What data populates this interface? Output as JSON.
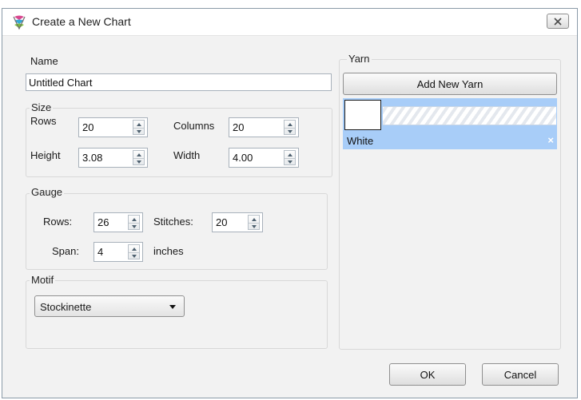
{
  "window": {
    "title": "Create a New Chart"
  },
  "name_field": {
    "label": "Name",
    "value": "Untitled Chart"
  },
  "size": {
    "title": "Size",
    "rows_label": "Rows",
    "rows_value": "20",
    "columns_label": "Columns",
    "columns_value": "20",
    "height_label": "Height",
    "height_value": "3.08",
    "width_label": "Width",
    "width_value": "4.00"
  },
  "gauge": {
    "title": "Gauge",
    "rows_label": "Rows:",
    "rows_value": "26",
    "stitches_label": "Stitches:",
    "stitches_value": "20",
    "span_label": "Span:",
    "span_value": "4",
    "span_unit": "inches"
  },
  "motif": {
    "title": "Motif",
    "selected": "Stockinette"
  },
  "yarn": {
    "title": "Yarn",
    "add_button": "Add New Yarn",
    "items": [
      {
        "name": "White",
        "color": "#ffffff",
        "remove_glyph": "×"
      }
    ],
    "selection_color": "#a8cdf8"
  },
  "footer": {
    "ok": "OK",
    "cancel": "Cancel"
  }
}
